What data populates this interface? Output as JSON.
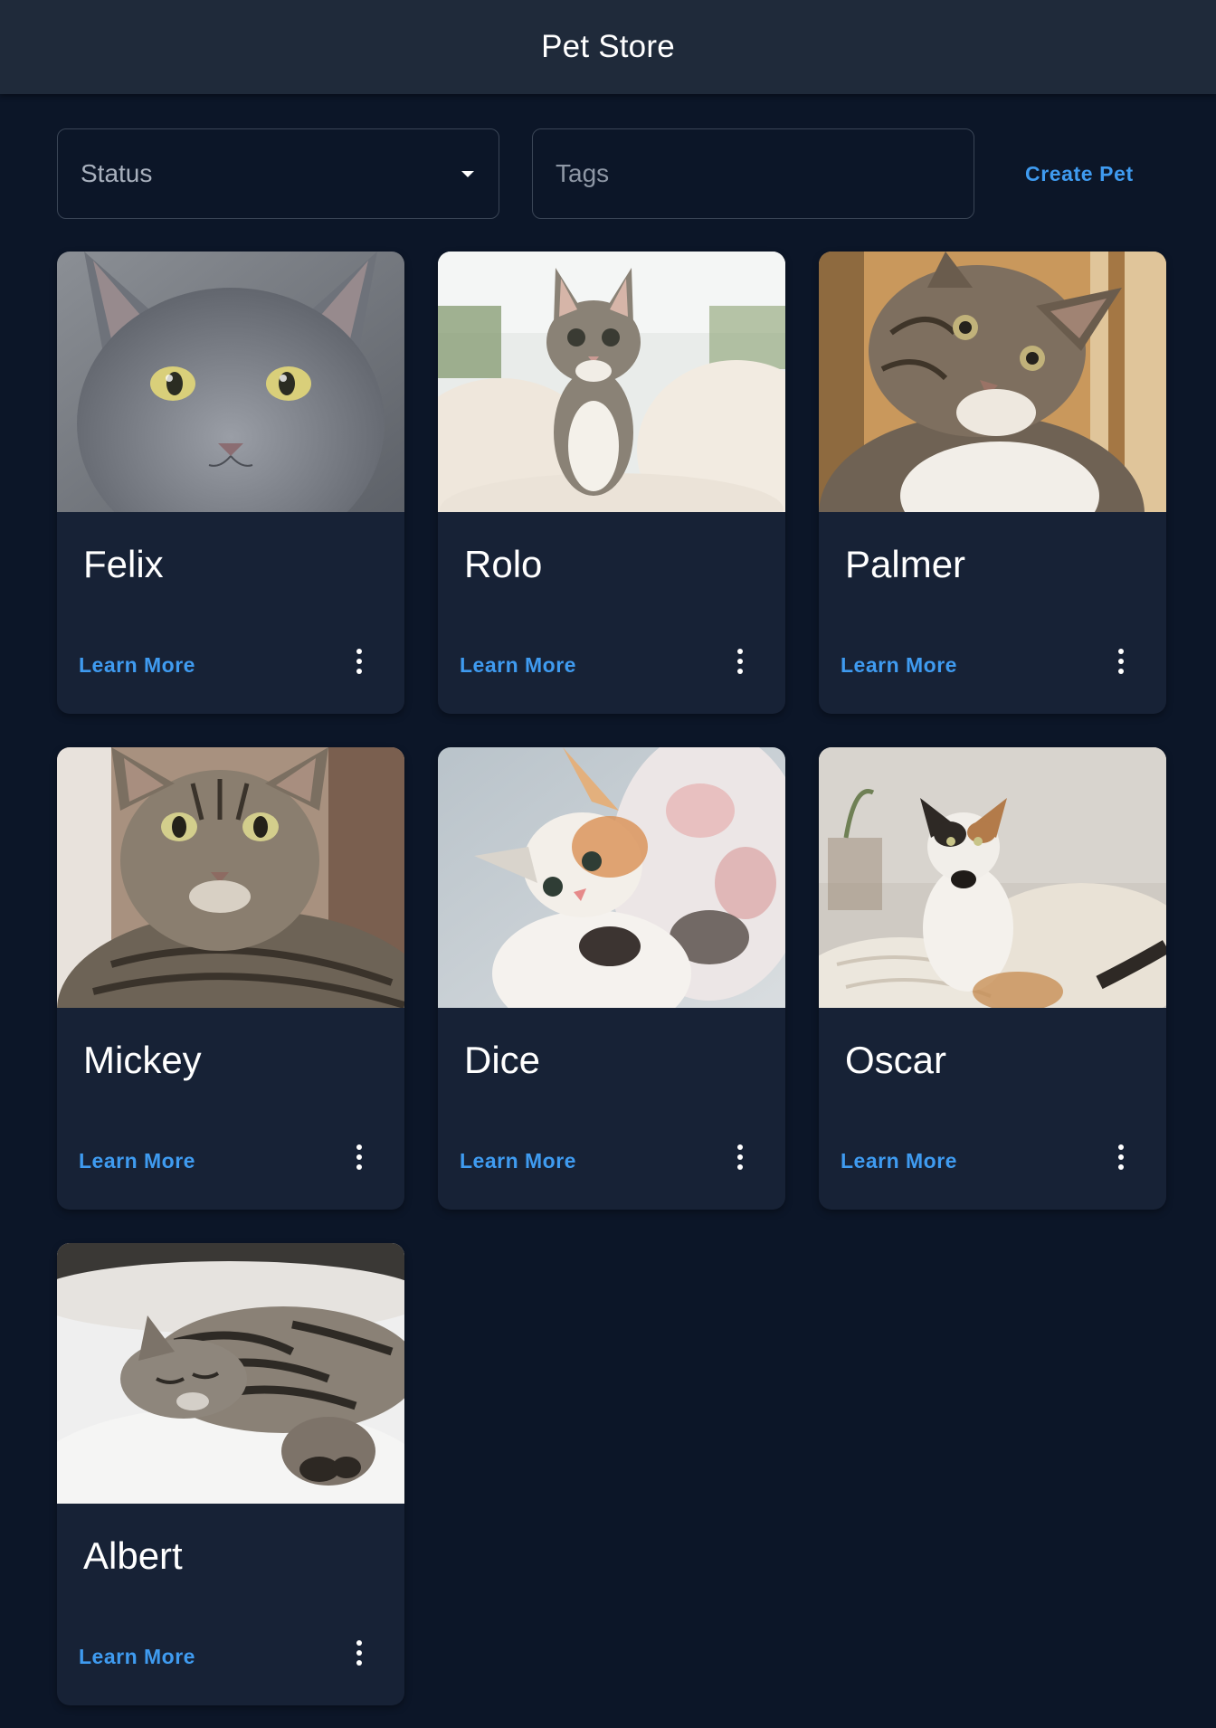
{
  "app": {
    "title": "Pet Store"
  },
  "filters": {
    "status": {
      "label": "Status",
      "icon": "arrow-drop-down-icon"
    },
    "tags": {
      "placeholder": "Tags",
      "value": ""
    },
    "create_pet_label": "Create Pet"
  },
  "pets": [
    {
      "name": "Felix",
      "learn_more_label": "Learn More",
      "menu_icon": "more-vert-icon",
      "image": "gray kitten portrait"
    },
    {
      "name": "Rolo",
      "learn_more_label": "Learn More",
      "menu_icon": "more-vert-icon",
      "image": "tabby kitten on blanket"
    },
    {
      "name": "Palmer",
      "learn_more_label": "Learn More",
      "menu_icon": "more-vert-icon",
      "image": "tabby and white cat looking up"
    },
    {
      "name": "Mickey",
      "learn_more_label": "Learn More",
      "menu_icon": "more-vert-icon",
      "image": "brown tabby cat"
    },
    {
      "name": "Dice",
      "learn_more_label": "Learn More",
      "menu_icon": "more-vert-icon",
      "image": "calico kitten reaching"
    },
    {
      "name": "Oscar",
      "learn_more_label": "Learn More",
      "menu_icon": "more-vert-icon",
      "image": "calico cat on bed"
    },
    {
      "name": "Albert",
      "learn_more_label": "Learn More",
      "menu_icon": "more-vert-icon",
      "image": "sleeping tabby cat"
    }
  ],
  "colors": {
    "background": "#0c1628",
    "app_bar": "#1f2a3a",
    "card": "#172236",
    "accent": "#3f9bf0",
    "text": "#ffffff",
    "field_border": "#3a4556"
  }
}
